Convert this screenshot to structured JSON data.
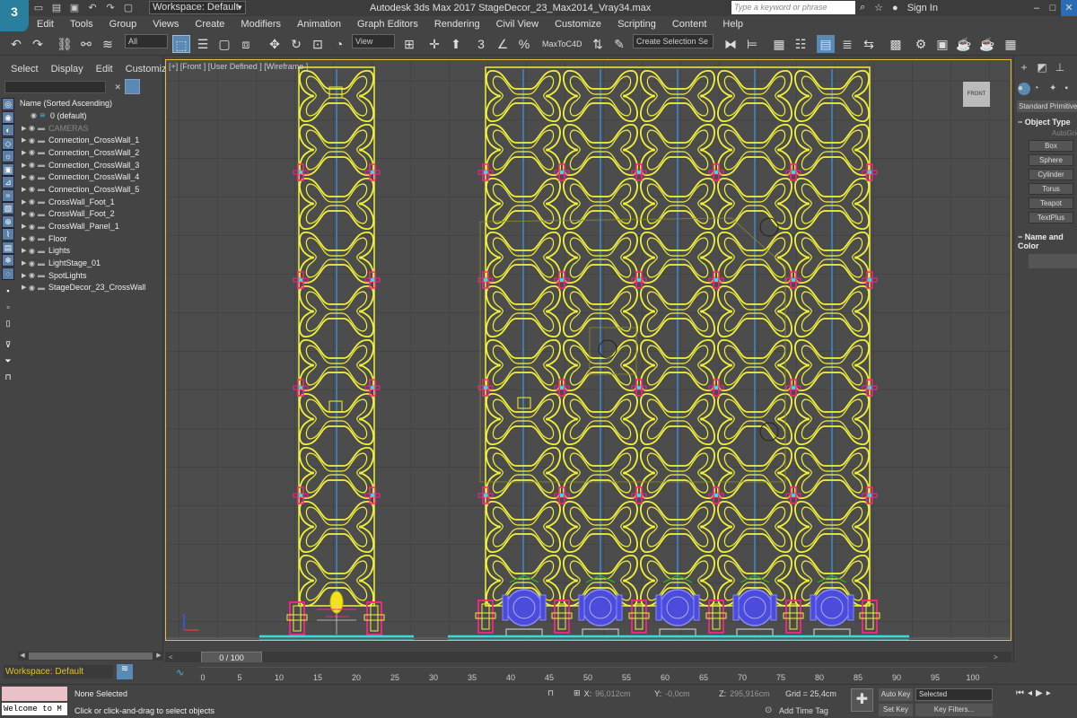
{
  "app": {
    "title": "Autodesk 3ds Max 2017    StageDecor_23_Max2014_Vray34.max",
    "logo": "3",
    "workspace": "Workspace: Default",
    "search_placeholder": "Type a keyword or phrase",
    "sign_in": "Sign In"
  },
  "menu": [
    "Edit",
    "Tools",
    "Group",
    "Views",
    "Create",
    "Modifiers",
    "Animation",
    "Graph Editors",
    "Rendering",
    "Civil View",
    "Customize",
    "Scripting",
    "Content",
    "Help"
  ],
  "toolbar": {
    "selection_filter": "All",
    "reference_coord": "View",
    "maxtoc4d": "MaxToC4D",
    "named_selection": "Create Selection Se"
  },
  "scene_explorer": {
    "tabs": [
      "Select",
      "Display",
      "Edit",
      "Customize"
    ],
    "header": "Name (Sorted Ascending)",
    "items": [
      {
        "name": "0 (default)",
        "dim": false
      },
      {
        "name": "CAMERAS",
        "dim": true
      },
      {
        "name": "Connection_CrossWall_1",
        "dim": false
      },
      {
        "name": "Connection_CrossWall_2",
        "dim": false
      },
      {
        "name": "Connection_CrossWall_3",
        "dim": false
      },
      {
        "name": "Connection_CrossWall_4",
        "dim": false
      },
      {
        "name": "Connection_CrossWall_5",
        "dim": false
      },
      {
        "name": "CrossWall_Foot_1",
        "dim": false
      },
      {
        "name": "CrossWall_Foot_2",
        "dim": false
      },
      {
        "name": "CrossWall_Panel_1",
        "dim": false
      },
      {
        "name": "Floor",
        "dim": false
      },
      {
        "name": "Lights",
        "dim": false
      },
      {
        "name": "LightStage_01",
        "dim": false
      },
      {
        "name": "SpotLights",
        "dim": false
      },
      {
        "name": "StageDecor_23_CrossWall",
        "dim": false
      }
    ]
  },
  "viewport": {
    "label": "[+] [Front ] [User Defined ] [Wireframe ]",
    "viewcube_label": "FRONT",
    "colors": {
      "wire": "#f2f23a",
      "accent": "#ff2288",
      "blue": "#5555ee",
      "cyan": "#33dddd",
      "line": "#3a8ad0"
    }
  },
  "command_panel": {
    "dropdown": "Standard Primitives",
    "object_type_header": "Object Type",
    "autogrid": "AutoGrid",
    "buttons": [
      "Box",
      "Sphere",
      "Cylinder",
      "Torus",
      "Teapot",
      "TextPlus"
    ],
    "name_color_header": "Name and Color"
  },
  "timeline": {
    "frame_display": "0 / 100",
    "ticks": [
      "0",
      "5",
      "10",
      "15",
      "20",
      "25",
      "30",
      "35",
      "40",
      "45",
      "50",
      "55",
      "60",
      "65",
      "70",
      "75",
      "80",
      "85",
      "90",
      "95",
      "100"
    ]
  },
  "status": {
    "selected": "None Selected",
    "prompt": "Click or click-and-drag to select objects",
    "listener": "Welcome to M",
    "x": "96,012cm",
    "y": "-0,0cm",
    "z": "295,916cm",
    "grid": "Grid = 25,4cm",
    "add_time_tag": "Add Time Tag",
    "auto_key": "Auto Key",
    "set_key": "Set Key",
    "key_mode": "Selected",
    "key_filters": "Key Filters..."
  }
}
